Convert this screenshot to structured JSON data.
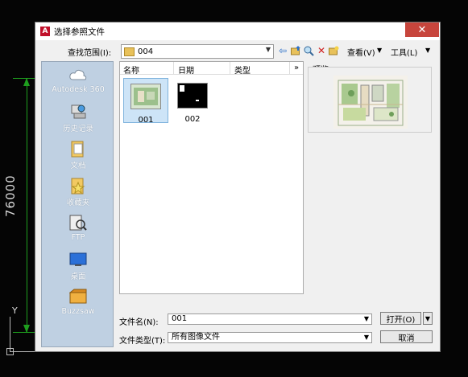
{
  "dialog": {
    "title": "选择参照文件",
    "close_glyph": "✕",
    "logo_letter": "A"
  },
  "toolbar": {
    "lookin_label": "查找范围(I):",
    "lookin_value": "004",
    "views_label": "查看(V)",
    "tools_label": "工具(L)"
  },
  "places": [
    {
      "label": "Autodesk 360",
      "icon": "cloud-icon"
    },
    {
      "label": "历史记录",
      "icon": "history-icon"
    },
    {
      "label": "文档",
      "icon": "documents-folder-icon"
    },
    {
      "label": "收藏夹",
      "icon": "favorites-folder-icon"
    },
    {
      "label": "FTP",
      "icon": "ftp-icon"
    },
    {
      "label": "桌面",
      "icon": "desktop-icon"
    },
    {
      "label": "Buzzsaw",
      "icon": "buzzsaw-icon"
    }
  ],
  "filelist": {
    "columns": [
      "名称",
      "日期",
      "类型",
      "»"
    ],
    "files": [
      {
        "name": "001",
        "selected": true
      },
      {
        "name": "002",
        "selected": false
      }
    ]
  },
  "preview": {
    "label": "预览"
  },
  "bottom": {
    "filename_label": "文件名(N):",
    "filename_value": "001",
    "filetype_label": "文件类型(T):",
    "filetype_value": "所有图像文件",
    "open_label": "打开(O)",
    "cancel_label": "取消"
  },
  "cad": {
    "dimension_text": "76000",
    "ucs_y_label": "Y"
  },
  "colors": {
    "dimension": "#1e9e1e",
    "places_panel": "#bfd0e2",
    "close_button": "#c7453c",
    "selection": "#cde4f7"
  }
}
